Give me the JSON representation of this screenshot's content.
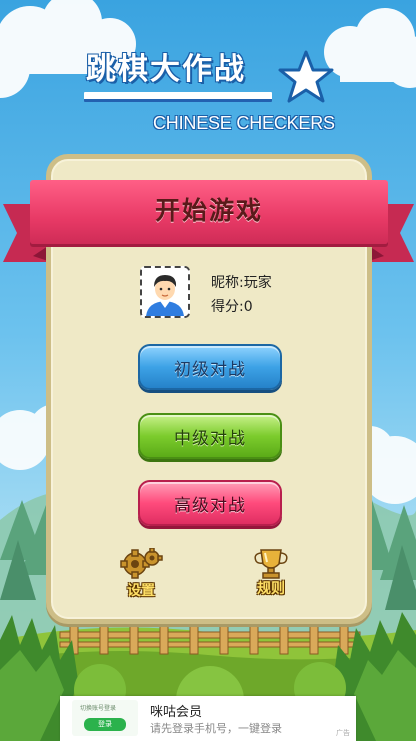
{
  "title": {
    "chinese": "跳棋大作战",
    "english": "CHINESE CHECKERS"
  },
  "menu": {
    "header": "开始游戏",
    "player": {
      "nickname_label": "昵称:",
      "nickname_value": "玩家",
      "score_label": "得分:",
      "score_value": "0"
    },
    "buttons": {
      "beginner": "初级对战",
      "intermediate": "中级对战",
      "advanced": "高级对战"
    },
    "settings_label": "设置",
    "rules_label": "规则"
  },
  "ad": {
    "thumb_text": "切换账号登录",
    "thumb_button": "登录",
    "title": "咪咕会员",
    "subtitle": "请先登录手机号，一键登录",
    "tag": "广告"
  },
  "colors": {
    "sky": "#3aa3e0",
    "ribbon": "#e83a66",
    "panel": "#efe9c6",
    "panel_border": "#cdbe87",
    "button_blue": "#3da2e6",
    "button_green": "#7ccc2d",
    "button_pink": "#ff4b7c"
  },
  "icons": {
    "settings": "gears-icon",
    "rules": "trophy-icon",
    "title_decoration": "star-icon"
  }
}
